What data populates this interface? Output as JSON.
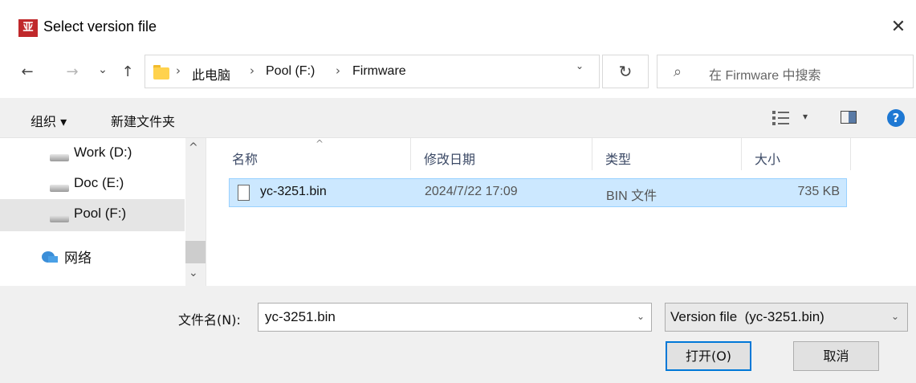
{
  "window": {
    "app_icon_text": "亚",
    "title": "Select version file",
    "close_glyph": "✕"
  },
  "nav": {
    "back_glyph": "←",
    "forward_glyph": "→",
    "recent_glyph": "⌄",
    "up_glyph": "↑",
    "breadcrumb": [
      "此电脑",
      "Pool (F:)",
      "Firmware"
    ],
    "separator": "›",
    "dropdown_glyph": "⌄",
    "refresh_glyph": "↻",
    "search_icon_glyph": "⌕",
    "search_placeholder": "在 Firmware 中搜索"
  },
  "toolbar": {
    "organize_label": "组织 ▾",
    "new_folder_label": "新建文件夹",
    "view_dropdown_glyph": "▾",
    "help_glyph": "?"
  },
  "sidebar": {
    "items": [
      {
        "label": "Work (D:)",
        "icon": "drive-icon"
      },
      {
        "label": "Doc (E:)",
        "icon": "drive-icon"
      },
      {
        "label": "Pool (F:)",
        "icon": "drive-icon",
        "selected": true
      },
      {
        "label": "网络",
        "icon": "network-icon"
      }
    ],
    "scroll_up_glyph": "^",
    "scroll_down_glyph": "⌄"
  },
  "files": {
    "sort_glyph": "^",
    "columns": [
      "名称",
      "修改日期",
      "类型",
      "大小"
    ],
    "rows": [
      {
        "name": "yc-3251.bin",
        "modified": "2024/7/22 17:09",
        "type": "BIN 文件",
        "size": "735 KB",
        "selected": true
      }
    ]
  },
  "footer": {
    "filename_label": "文件名(N):",
    "filename_value": "yc-3251.bin",
    "filename_dropdown_glyph": "⌄",
    "filetype_value": "Version file  (yc-3251.bin)",
    "filetype_dropdown_glyph": "⌄",
    "open_label": "打开(O)",
    "cancel_label": "取消"
  },
  "colors": {
    "accent": "#0078d7",
    "selection_bg": "#cce8ff",
    "selection_border": "#99d1ff",
    "app_icon_bg": "#c0282b"
  }
}
